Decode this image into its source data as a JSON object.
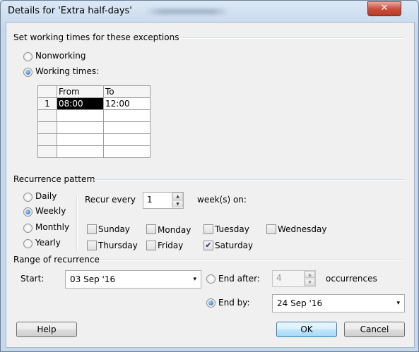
{
  "window": {
    "title": "Details for 'Extra half-days'",
    "close_symbol": "✕"
  },
  "exceptions": {
    "title": "Set working times for these exceptions",
    "nonworking_label": "Nonworking",
    "working_times_label": "Working times:",
    "selected": "working_times"
  },
  "times_grid": {
    "headers": [
      "",
      "From",
      "To"
    ],
    "rows": [
      {
        "num": "1",
        "from": "08:00",
        "to": "12:00"
      },
      {
        "num": "",
        "from": "",
        "to": ""
      },
      {
        "num": "",
        "from": "",
        "to": ""
      },
      {
        "num": "",
        "from": "",
        "to": ""
      },
      {
        "num": "",
        "from": "",
        "to": ""
      }
    ]
  },
  "recurrence": {
    "title": "Recurrence pattern",
    "options": {
      "daily": "Daily",
      "weekly": "Weekly",
      "monthly": "Monthly",
      "yearly": "Yearly"
    },
    "selected": "weekly",
    "recur_every_label": "Recur every",
    "recur_every_value": "1",
    "weeks_on_label": "week(s) on:",
    "days": {
      "sunday": "Sunday",
      "monday": "Monday",
      "tuesday": "Tuesday",
      "wednesday": "Wednesday",
      "thursday": "Thursday",
      "friday": "Friday",
      "saturday": "Saturday"
    },
    "checked_days": [
      "saturday"
    ]
  },
  "range": {
    "title": "Range of recurrence",
    "start_label": "Start:",
    "start_value": "03 Sep '16",
    "end_after_label": "End after:",
    "end_after_value": "4",
    "occurrences_label": "occurrences",
    "end_by_label": "End by:",
    "end_by_value": "24 Sep '16",
    "selected": "end_by"
  },
  "buttons": {
    "help": "Help",
    "ok": "OK",
    "cancel": "Cancel"
  },
  "icons": {
    "dropdown": "▾",
    "spin_up": "▲",
    "spin_down": "▼",
    "check": "✔"
  }
}
